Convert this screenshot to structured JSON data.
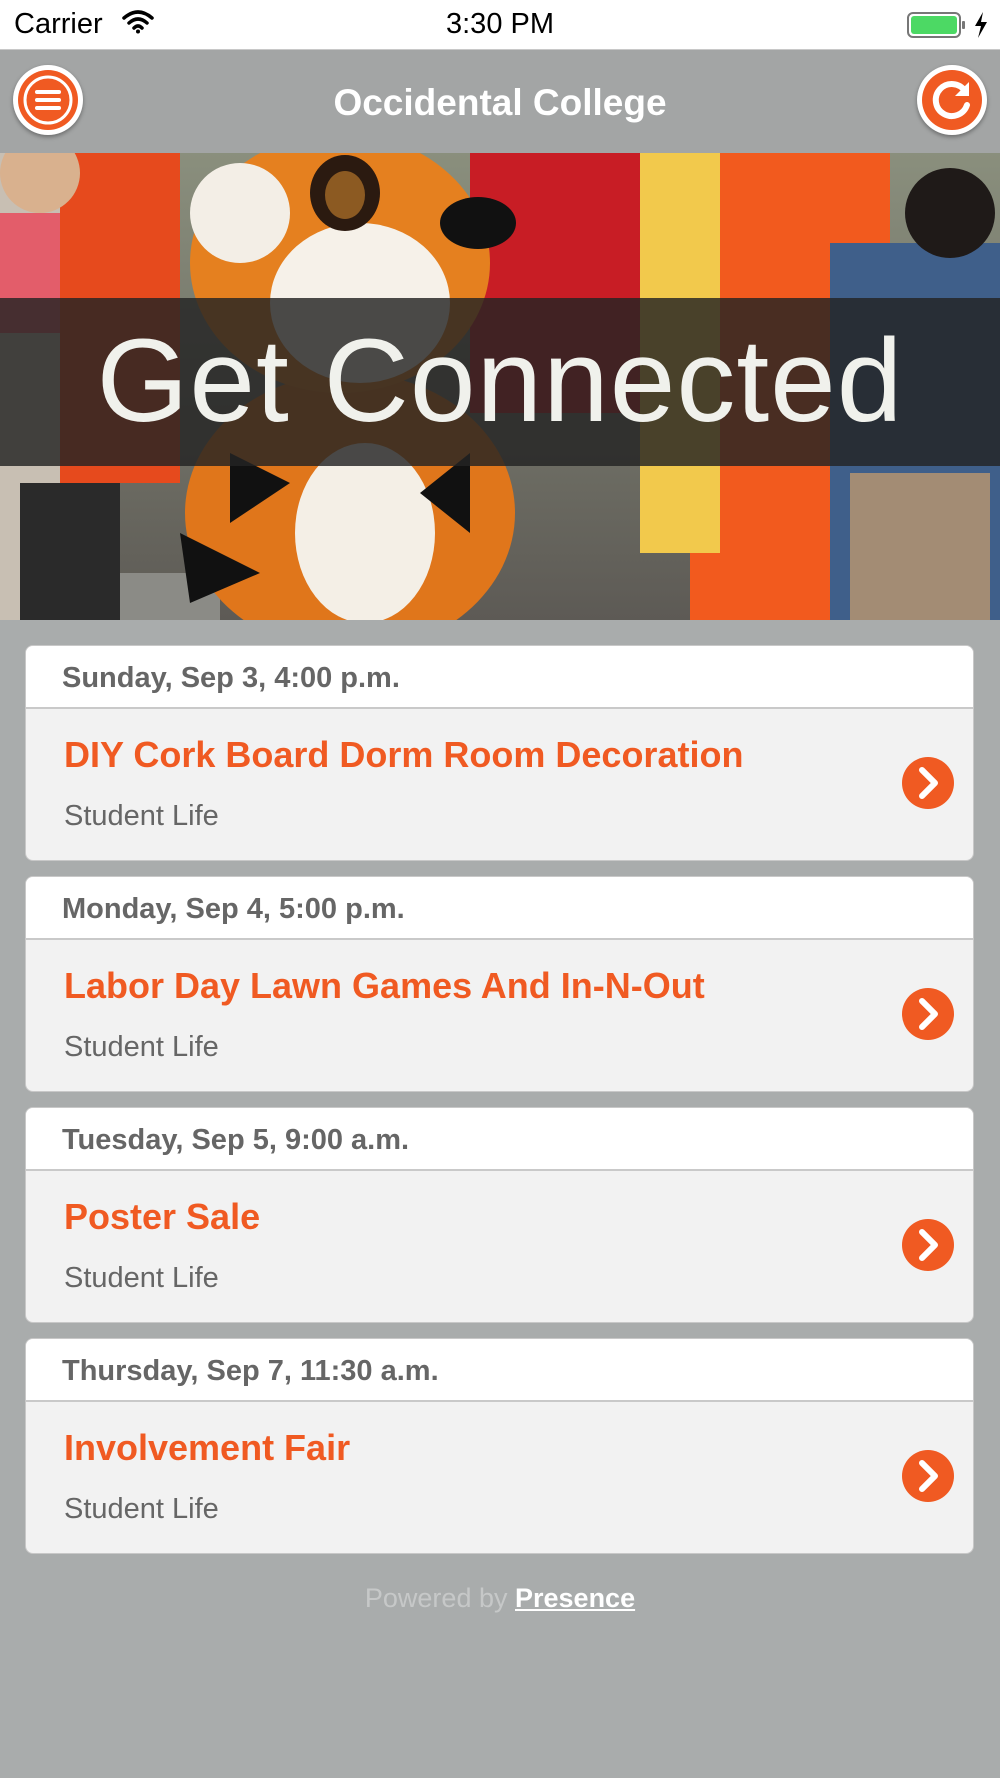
{
  "status_bar": {
    "carrier": "Carrier",
    "time": "3:30 PM"
  },
  "nav": {
    "title": "Occidental College",
    "menu_icon": "hamburger-menu-icon",
    "refresh_icon": "refresh-icon"
  },
  "hero": {
    "text": "Get Connected"
  },
  "events": [
    {
      "date": "Sunday, Sep 3, 4:00 p.m.",
      "title": "DIY Cork Board Dorm Room Decoration",
      "category": "Student Life"
    },
    {
      "date": "Monday, Sep 4, 5:00 p.m.",
      "title": "Labor Day Lawn Games And In-N-Out",
      "category": "Student Life"
    },
    {
      "date": "Tuesday, Sep 5, 9:00 a.m.",
      "title": "Poster Sale",
      "category": "Student Life"
    },
    {
      "date": "Thursday, Sep 7, 11:30 a.m.",
      "title": "Involvement Fair",
      "category": "Student Life"
    }
  ],
  "footer": {
    "powered_prefix": "Powered by",
    "powered_link": "Presence"
  },
  "colors": {
    "accent": "#f05a22",
    "nav_bg": "#a3a5a5",
    "page_bg": "#a9acac"
  }
}
